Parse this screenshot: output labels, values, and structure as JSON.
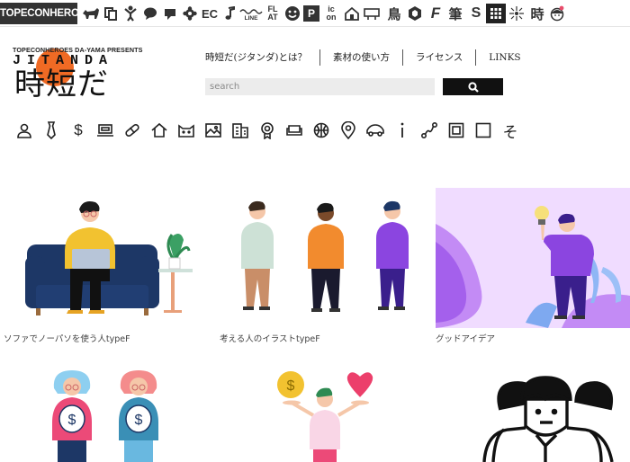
{
  "topbar": {
    "brand": "TOPECONHEROES",
    "icons": [
      {
        "name": "animal-icon"
      },
      {
        "name": "copy-icon"
      },
      {
        "name": "person-icon"
      },
      {
        "name": "speech-bubble-icon"
      },
      {
        "name": "arrow-icon"
      },
      {
        "name": "gear-icon"
      },
      {
        "name": "ec-icon",
        "text": "EC"
      },
      {
        "name": "music-note-icon"
      },
      {
        "name": "line-icon"
      },
      {
        "name": "flat-icon",
        "text": "FL AT"
      },
      {
        "name": "smiley-icon"
      },
      {
        "name": "parking-icon",
        "text": "P"
      },
      {
        "name": "icon-text-icon",
        "text": "ic on"
      },
      {
        "name": "house-icon"
      },
      {
        "name": "sign-icon"
      },
      {
        "name": "bird-icon",
        "text": "鳥"
      },
      {
        "name": "hexagon-icon"
      },
      {
        "name": "font-icon",
        "text": "F"
      },
      {
        "name": "brush-icon",
        "text": "筆"
      },
      {
        "name": "s-icon",
        "text": "S"
      },
      {
        "name": "grid-icon"
      },
      {
        "name": "sparkle-icon"
      },
      {
        "name": "clock-kanji-icon",
        "text": "時"
      },
      {
        "name": "girl-face-icon"
      }
    ]
  },
  "header": {
    "logo_tag": "TOPECONHEROES DA-YAMA PRESENTS",
    "logo_latin": "JITANDA",
    "logo_jp": "時短だ",
    "nav": [
      {
        "label": "時短だ(ジタンダ)とは？"
      },
      {
        "label": "素材の使い方"
      },
      {
        "label": "ライセンス"
      },
      {
        "label": "LINKS"
      }
    ],
    "search": {
      "placeholder": "search"
    }
  },
  "categories": [
    "person-icon",
    "tie-icon",
    "dollar-icon",
    "laptop-icon",
    "pill-icon",
    "house-icon",
    "cat-icon",
    "image-icon",
    "building-icon",
    "medal-icon",
    "sofa-icon",
    "ball-icon",
    "pin-icon",
    "car-icon",
    "info-icon",
    "route-icon",
    "frame-icon",
    "square-icon",
    "hiragana-so-icon"
  ],
  "categories_so_text": "そ",
  "gallery": [
    {
      "caption": "ソファでノーパソを使う人typeF"
    },
    {
      "caption": "考える人のイラストtypeF"
    },
    {
      "caption": "グッドアイデア"
    },
    {
      "caption": ""
    },
    {
      "caption": ""
    },
    {
      "caption": ""
    }
  ],
  "colors": {
    "accent_orange": "#f06a24",
    "purple": "#8b45e0",
    "yellow": "#f2c230",
    "navy": "#1d3766",
    "pink": "#ec4a78"
  }
}
